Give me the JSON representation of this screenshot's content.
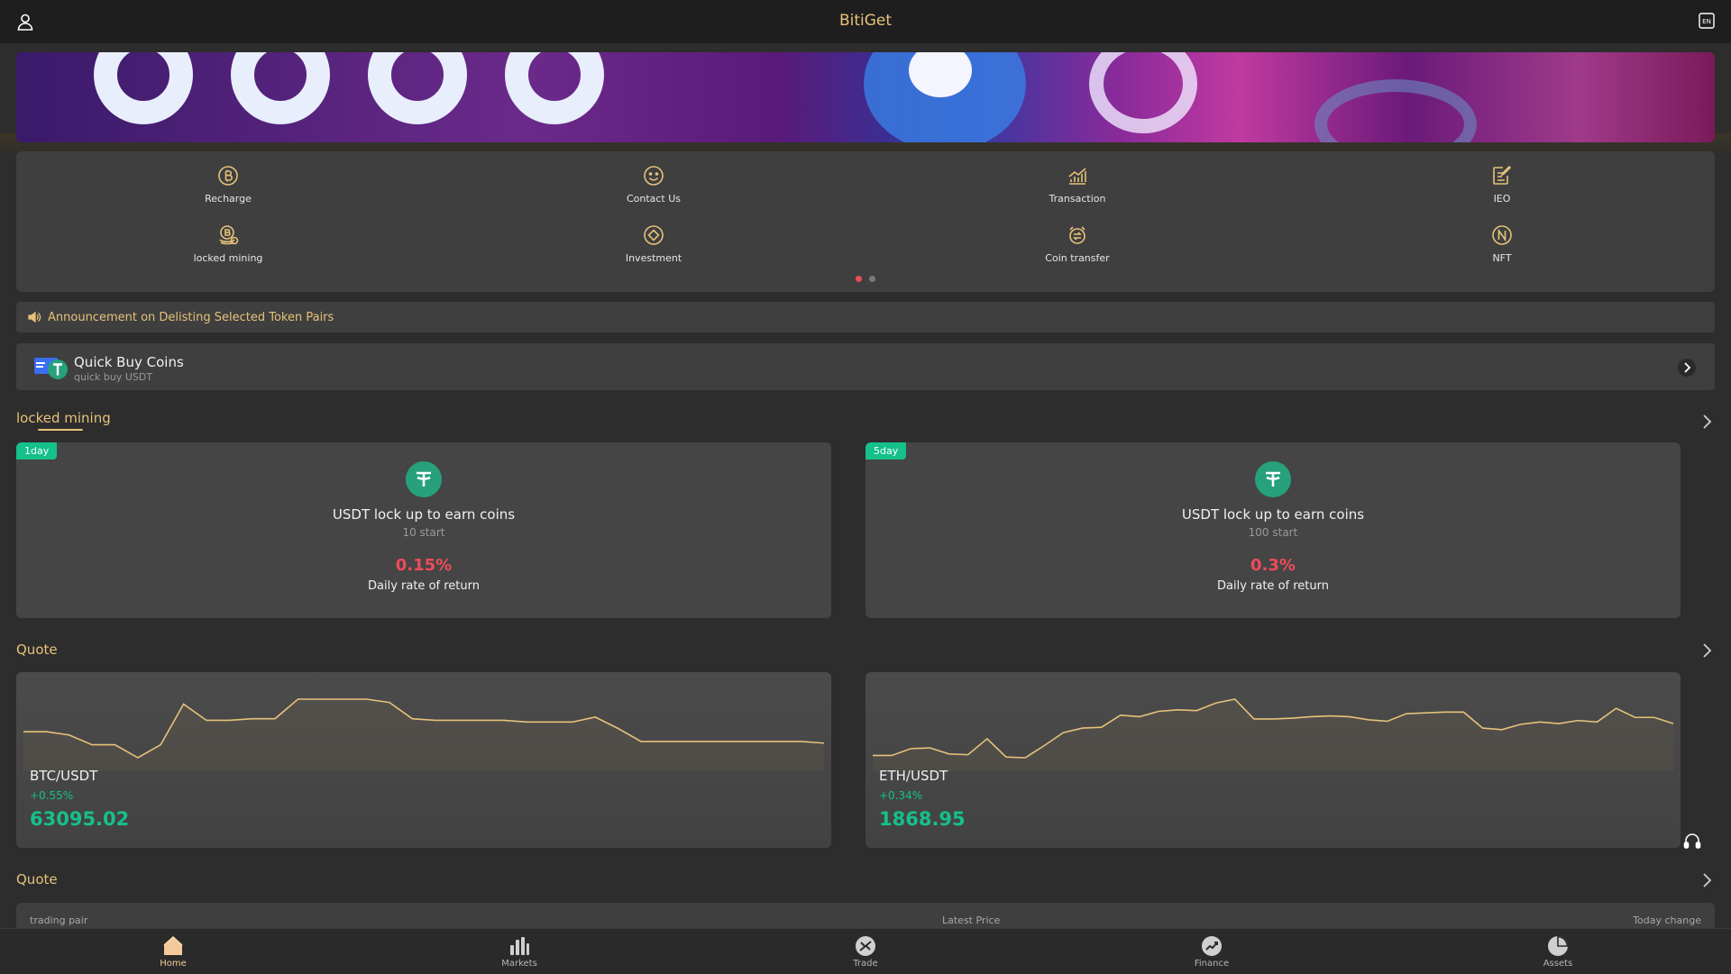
{
  "header": {
    "title": "BitiGet",
    "lang_badge": "EN"
  },
  "menu": {
    "items": [
      {
        "label": "Recharge",
        "icon": "bitcoin-coin-icon"
      },
      {
        "label": "Contact Us",
        "icon": "smiley-face-icon"
      },
      {
        "label": "Transaction",
        "icon": "trend-chart-icon"
      },
      {
        "label": "IEO",
        "icon": "document-edit-icon"
      },
      {
        "label": "locked mining",
        "icon": "coin-stack-icon"
      },
      {
        "label": "Investment",
        "icon": "diamond-circle-icon"
      },
      {
        "label": "Coin transfer",
        "icon": "transfer-icon"
      },
      {
        "label": "NFT",
        "icon": "nft-badge-icon"
      }
    ],
    "pager": {
      "pages": 2,
      "active": 1
    }
  },
  "announcement": {
    "text": "Announcement on Delisting Selected Token Pairs"
  },
  "quick_buy": {
    "title": "Quick Buy Coins",
    "subtitle": "quick buy USDT"
  },
  "mining": {
    "section_title": "locked mining",
    "cards": [
      {
        "tag": "1day",
        "title": "USDT lock up to earn coins",
        "start": "10 start",
        "rate": "0.15%",
        "rate_label": "Daily rate of return"
      },
      {
        "tag": "5day",
        "title": "USDT lock up to earn coins",
        "start": "100 start",
        "rate": "0.3%",
        "rate_label": "Daily rate of return"
      }
    ]
  },
  "quote": {
    "section_title": "Quote",
    "cards": [
      {
        "pair": "BTC/USDT",
        "change": "+0.55%",
        "price": "63095.02",
        "sparkline": [
          63090,
          63090,
          63088,
          63082,
          63082,
          63074,
          63082,
          63107,
          63097,
          63097,
          63098,
          63098,
          63110,
          63110,
          63110,
          63110,
          63108,
          63098,
          63097,
          63097,
          63097,
          63097,
          63096,
          63096,
          63096,
          63099,
          63092,
          63084,
          63084,
          63084,
          63084,
          63084,
          63084,
          63084,
          63084,
          63083
        ]
      },
      {
        "pair": "ETH/USDT",
        "change": "+0.34%",
        "price": "1868.95",
        "sparkline": [
          1866.3,
          1866.3,
          1867.2,
          1867.3,
          1866.5,
          1866.4,
          1868.5,
          1866.1,
          1866.0,
          1867.6,
          1869.3,
          1869.9,
          1870.0,
          1871.6,
          1871.4,
          1872.1,
          1872.3,
          1872.2,
          1873.2,
          1873.7,
          1871.1,
          1871.1,
          1871.2,
          1871.4,
          1871.5,
          1871.4,
          1871.0,
          1870.8,
          1871.8,
          1871.9,
          1872.0,
          1872.0,
          1869.9,
          1869.7,
          1870.4,
          1870.7,
          1870.5,
          1870.9,
          1870.7,
          1872.5,
          1871.3,
          1871.3,
          1870.5
        ]
      }
    ]
  },
  "quote_table": {
    "section_title": "Quote",
    "columns": [
      "trading pair",
      "Latest Price",
      "Today change"
    ]
  },
  "bottom_nav": {
    "tabs": [
      {
        "label": "Home",
        "icon": "home-icon",
        "active": true
      },
      {
        "label": "Markets",
        "icon": "bar-chart-icon",
        "active": false
      },
      {
        "label": "Trade",
        "icon": "trade-icon",
        "active": false
      },
      {
        "label": "Finance",
        "icon": "finance-icon",
        "active": false
      },
      {
        "label": "Assets",
        "icon": "pie-chart-icon",
        "active": false
      }
    ]
  },
  "colors": {
    "accent": "#e6c27a",
    "up": "#15c08a",
    "rate": "#ef4b5a",
    "card": "#454545",
    "background": "#2d2d2d"
  }
}
